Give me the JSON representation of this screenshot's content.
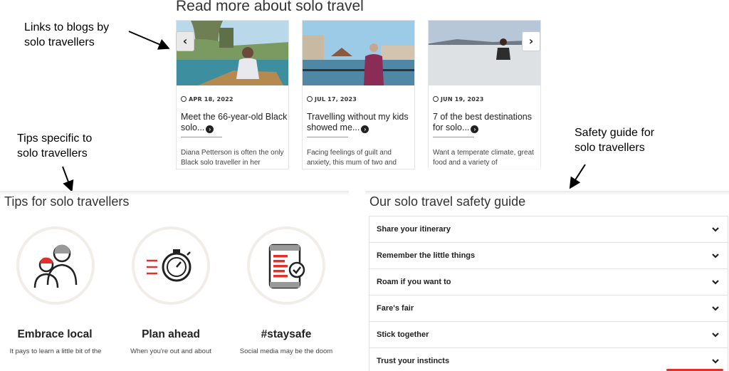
{
  "annotations": {
    "blogs": "Links to blogs by\nsolo travellers",
    "tips": "Tips specific to\nsolo travellers",
    "safety": "Safety guide for\nsolo travellers"
  },
  "blogs": {
    "title": "Read more about solo travel",
    "prev_icon": "chevron-left-icon",
    "next_icon": "chevron-right-icon",
    "cards": [
      {
        "date": "APR 18, 2022",
        "headline": "Meet the 66-year-old Black solo...",
        "excerpt": "Diana Petterson is often the only Black solo traveller in her"
      },
      {
        "date": "JUL 17, 2023",
        "headline": "Travelling without my kids showed me...",
        "excerpt": "Facing feelings of guilt and anxiety, this mum of two and"
      },
      {
        "date": "JUN 19, 2023",
        "headline": "7 of the best destinations for solo...",
        "excerpt": "Want a temperate climate, great food and a variety of"
      }
    ]
  },
  "tips": {
    "title": "Tips for solo travellers",
    "items": [
      {
        "name": "Embrace local",
        "desc": "It pays to learn a little bit of the",
        "icon": "people-icon"
      },
      {
        "name": "Plan ahead",
        "desc": "When you're out and about",
        "icon": "stopwatch-icon"
      },
      {
        "name": "#staysafe",
        "desc": "Social media may be the doom",
        "icon": "phone-check-icon"
      }
    ]
  },
  "guide": {
    "title": "Our solo travel safety guide",
    "items": [
      "Share your itinerary",
      "Remember the little things",
      "Roam if you want to",
      "Fare's fair",
      "Stick together",
      "Trust your instincts"
    ]
  },
  "colors": {
    "accent_red": "#e0312b",
    "circle_border": "#f1eee9",
    "text_dark": "#222222"
  }
}
